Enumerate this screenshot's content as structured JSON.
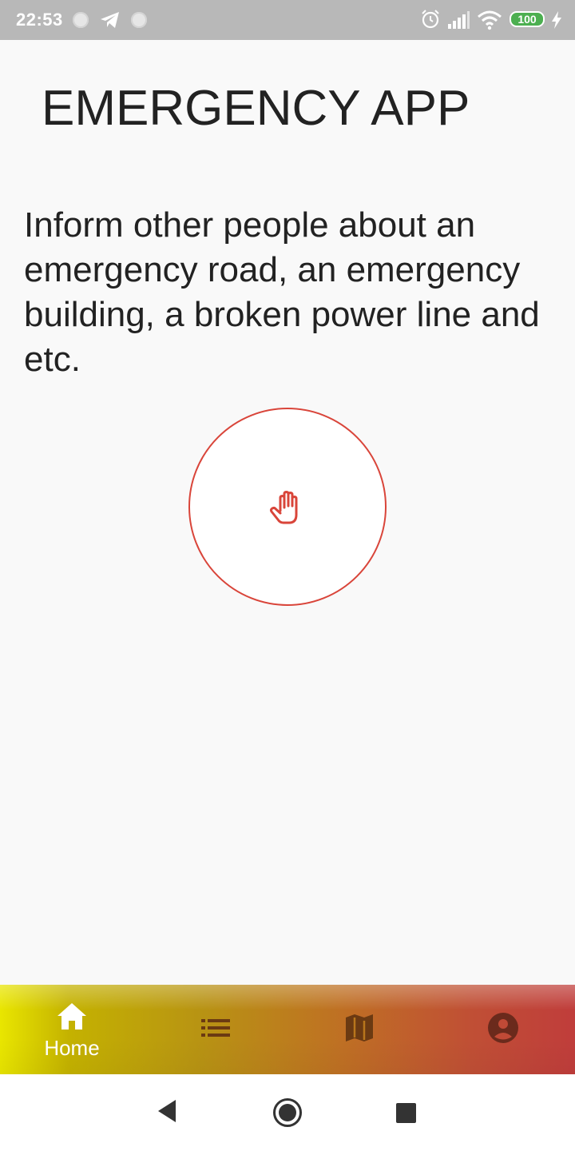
{
  "status_bar": {
    "time": "22:53",
    "battery": "100",
    "icons": [
      "notification-dot-icon",
      "telegram-icon",
      "notification-dot-icon",
      "alarm-icon",
      "signal-icon",
      "wifi-icon",
      "battery-icon",
      "charging-icon"
    ]
  },
  "app": {
    "title": "EMERGENCY APP",
    "description": "Inform other people about an emergency road, an emergency building, a broken power line and etc.",
    "action_button_icon": "hand-icon"
  },
  "colors": {
    "accent_red": "#d9453a",
    "nav_gradient": [
      "#e9e600",
      "#b89313",
      "#bf6f24",
      "#c03d3b"
    ],
    "nav_icon_inactive": "#6b3a12",
    "nav_icon_active": "#ffffff"
  },
  "bottom_nav": {
    "active_index": 0,
    "items": [
      {
        "label": "Home",
        "icon": "home-icon"
      },
      {
        "label": "",
        "icon": "list-icon"
      },
      {
        "label": "",
        "icon": "map-icon"
      },
      {
        "label": "",
        "icon": "account-icon"
      }
    ]
  },
  "system_nav": {
    "buttons": [
      "back-icon",
      "home-circle-icon",
      "recents-icon"
    ]
  }
}
